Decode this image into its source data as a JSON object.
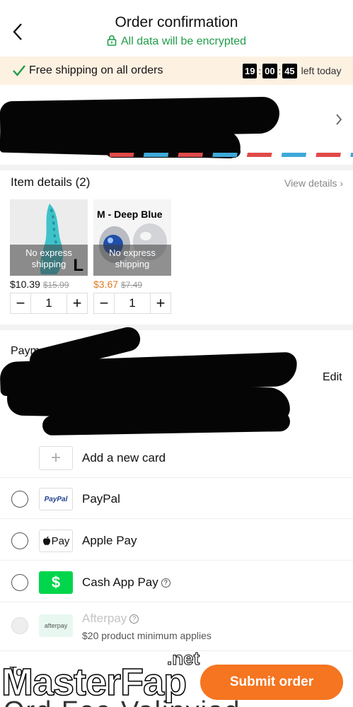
{
  "header": {
    "title": "Order confirmation",
    "secure_text": "All data will be encrypted"
  },
  "promo": {
    "text": "Free shipping on all orders",
    "timer": {
      "hours": "19",
      "minutes": "00",
      "seconds": "45"
    },
    "timer_suffix": "left today"
  },
  "items": {
    "title": "Item details (2)",
    "view_details": "View details",
    "list": [
      {
        "badge": "No express shipping",
        "size_tag": "L",
        "price": "$10.39",
        "original_price": "$15.99",
        "quantity": "1"
      },
      {
        "badge": "No express shipping",
        "variant": "M - Deep Blue",
        "price": "$3.67",
        "original_price": "$7.49",
        "quantity": "1"
      }
    ]
  },
  "payment": {
    "title": "Payment method",
    "edit": "Edit",
    "add_card": "Add a new card",
    "options": [
      {
        "label": "PayPal",
        "logo": "PayPal"
      },
      {
        "label": "Apple Pay",
        "logo": "Pay"
      },
      {
        "label": "Cash App Pay",
        "logo": "$"
      },
      {
        "label": "Afterpay",
        "logo": "afterpay",
        "note": "$20 product minimum applies"
      }
    ]
  },
  "footer": {
    "submit": "Submit order",
    "total_label": "To",
    "bottom_text": "Ord  Fee  Valinviad"
  },
  "watermark": {
    "left": "Master",
    "right": "Fap",
    "suffix": ".net"
  },
  "colors": {
    "accent": "#f57520",
    "secure_green": "#1f9d47",
    "promo_bg": "#fdf1e2",
    "cashapp": "#00d54b"
  }
}
